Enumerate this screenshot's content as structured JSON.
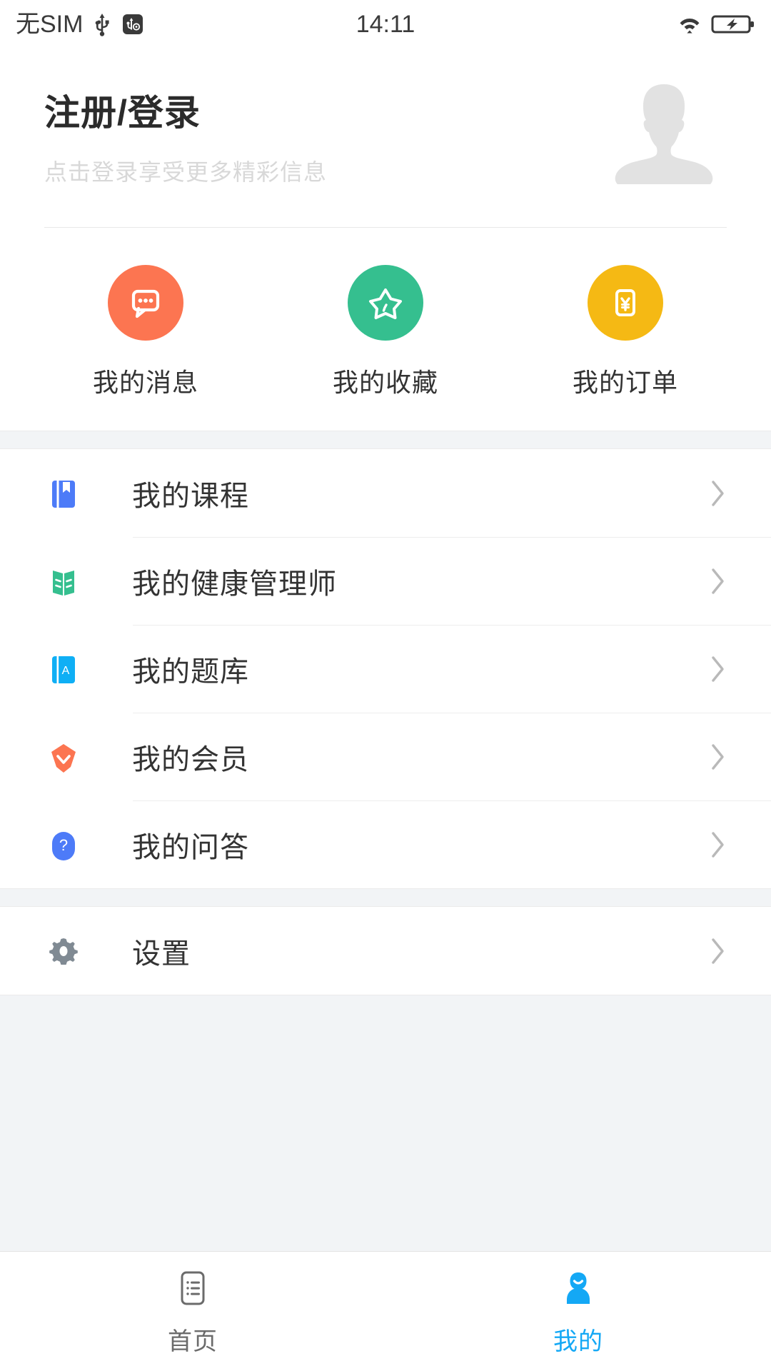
{
  "status_bar": {
    "carrier": "无SIM",
    "time": "14:11",
    "usb_icon": "usb-icon",
    "usb_debug_icon": "usb-debug-icon",
    "wifi_icon": "wifi-icon",
    "battery_icon": "battery-charging-icon"
  },
  "profile": {
    "title": "注册/登录",
    "subtitle": "点击登录享受更多精彩信息",
    "avatar_icon": "avatar-placeholder-icon",
    "avatar_color": "#E2E2E2"
  },
  "quick_actions": [
    {
      "label": "我的消息",
      "icon": "message-icon",
      "color": "#FC7551"
    },
    {
      "label": "我的收藏",
      "icon": "star-icon",
      "color": "#35BF8F"
    },
    {
      "label": "我的订单",
      "icon": "order-card-icon",
      "color": "#F5B914"
    }
  ],
  "menu_group_1": [
    {
      "label": "我的课程",
      "icon": "book-bookmark-icon",
      "color": "#4D7BF8",
      "chevron": "chevron-right-icon"
    },
    {
      "label": "我的健康管理师",
      "icon": "open-book-icon",
      "color": "#35BF8F",
      "chevron": "chevron-right-icon"
    },
    {
      "label": "我的题库",
      "icon": "book-a-icon",
      "color": "#0FAFF5",
      "chevron": "chevron-right-icon"
    },
    {
      "label": "我的会员",
      "icon": "member-badge-icon",
      "color": "#FC7551",
      "chevron": "chevron-right-icon"
    },
    {
      "label": "我的问答",
      "icon": "question-circle-icon",
      "color": "#4D7BF8",
      "chevron": "chevron-right-icon"
    }
  ],
  "menu_group_2": [
    {
      "label": "设置",
      "icon": "gear-icon",
      "color": "#808A93",
      "chevron": "chevron-right-icon"
    }
  ],
  "tab_bar": [
    {
      "label": "首页",
      "icon": "home-list-icon",
      "active": false,
      "color": "#6b6b6b"
    },
    {
      "label": "我的",
      "icon": "person-icon",
      "active": true,
      "color": "#14A8F5"
    }
  ],
  "colors": {
    "accent": "#14A8F5",
    "page_bg": "#FFFFFF",
    "section_bg": "#F2F4F6",
    "text_primary": "#333333",
    "text_muted": "#D8D8D8"
  }
}
